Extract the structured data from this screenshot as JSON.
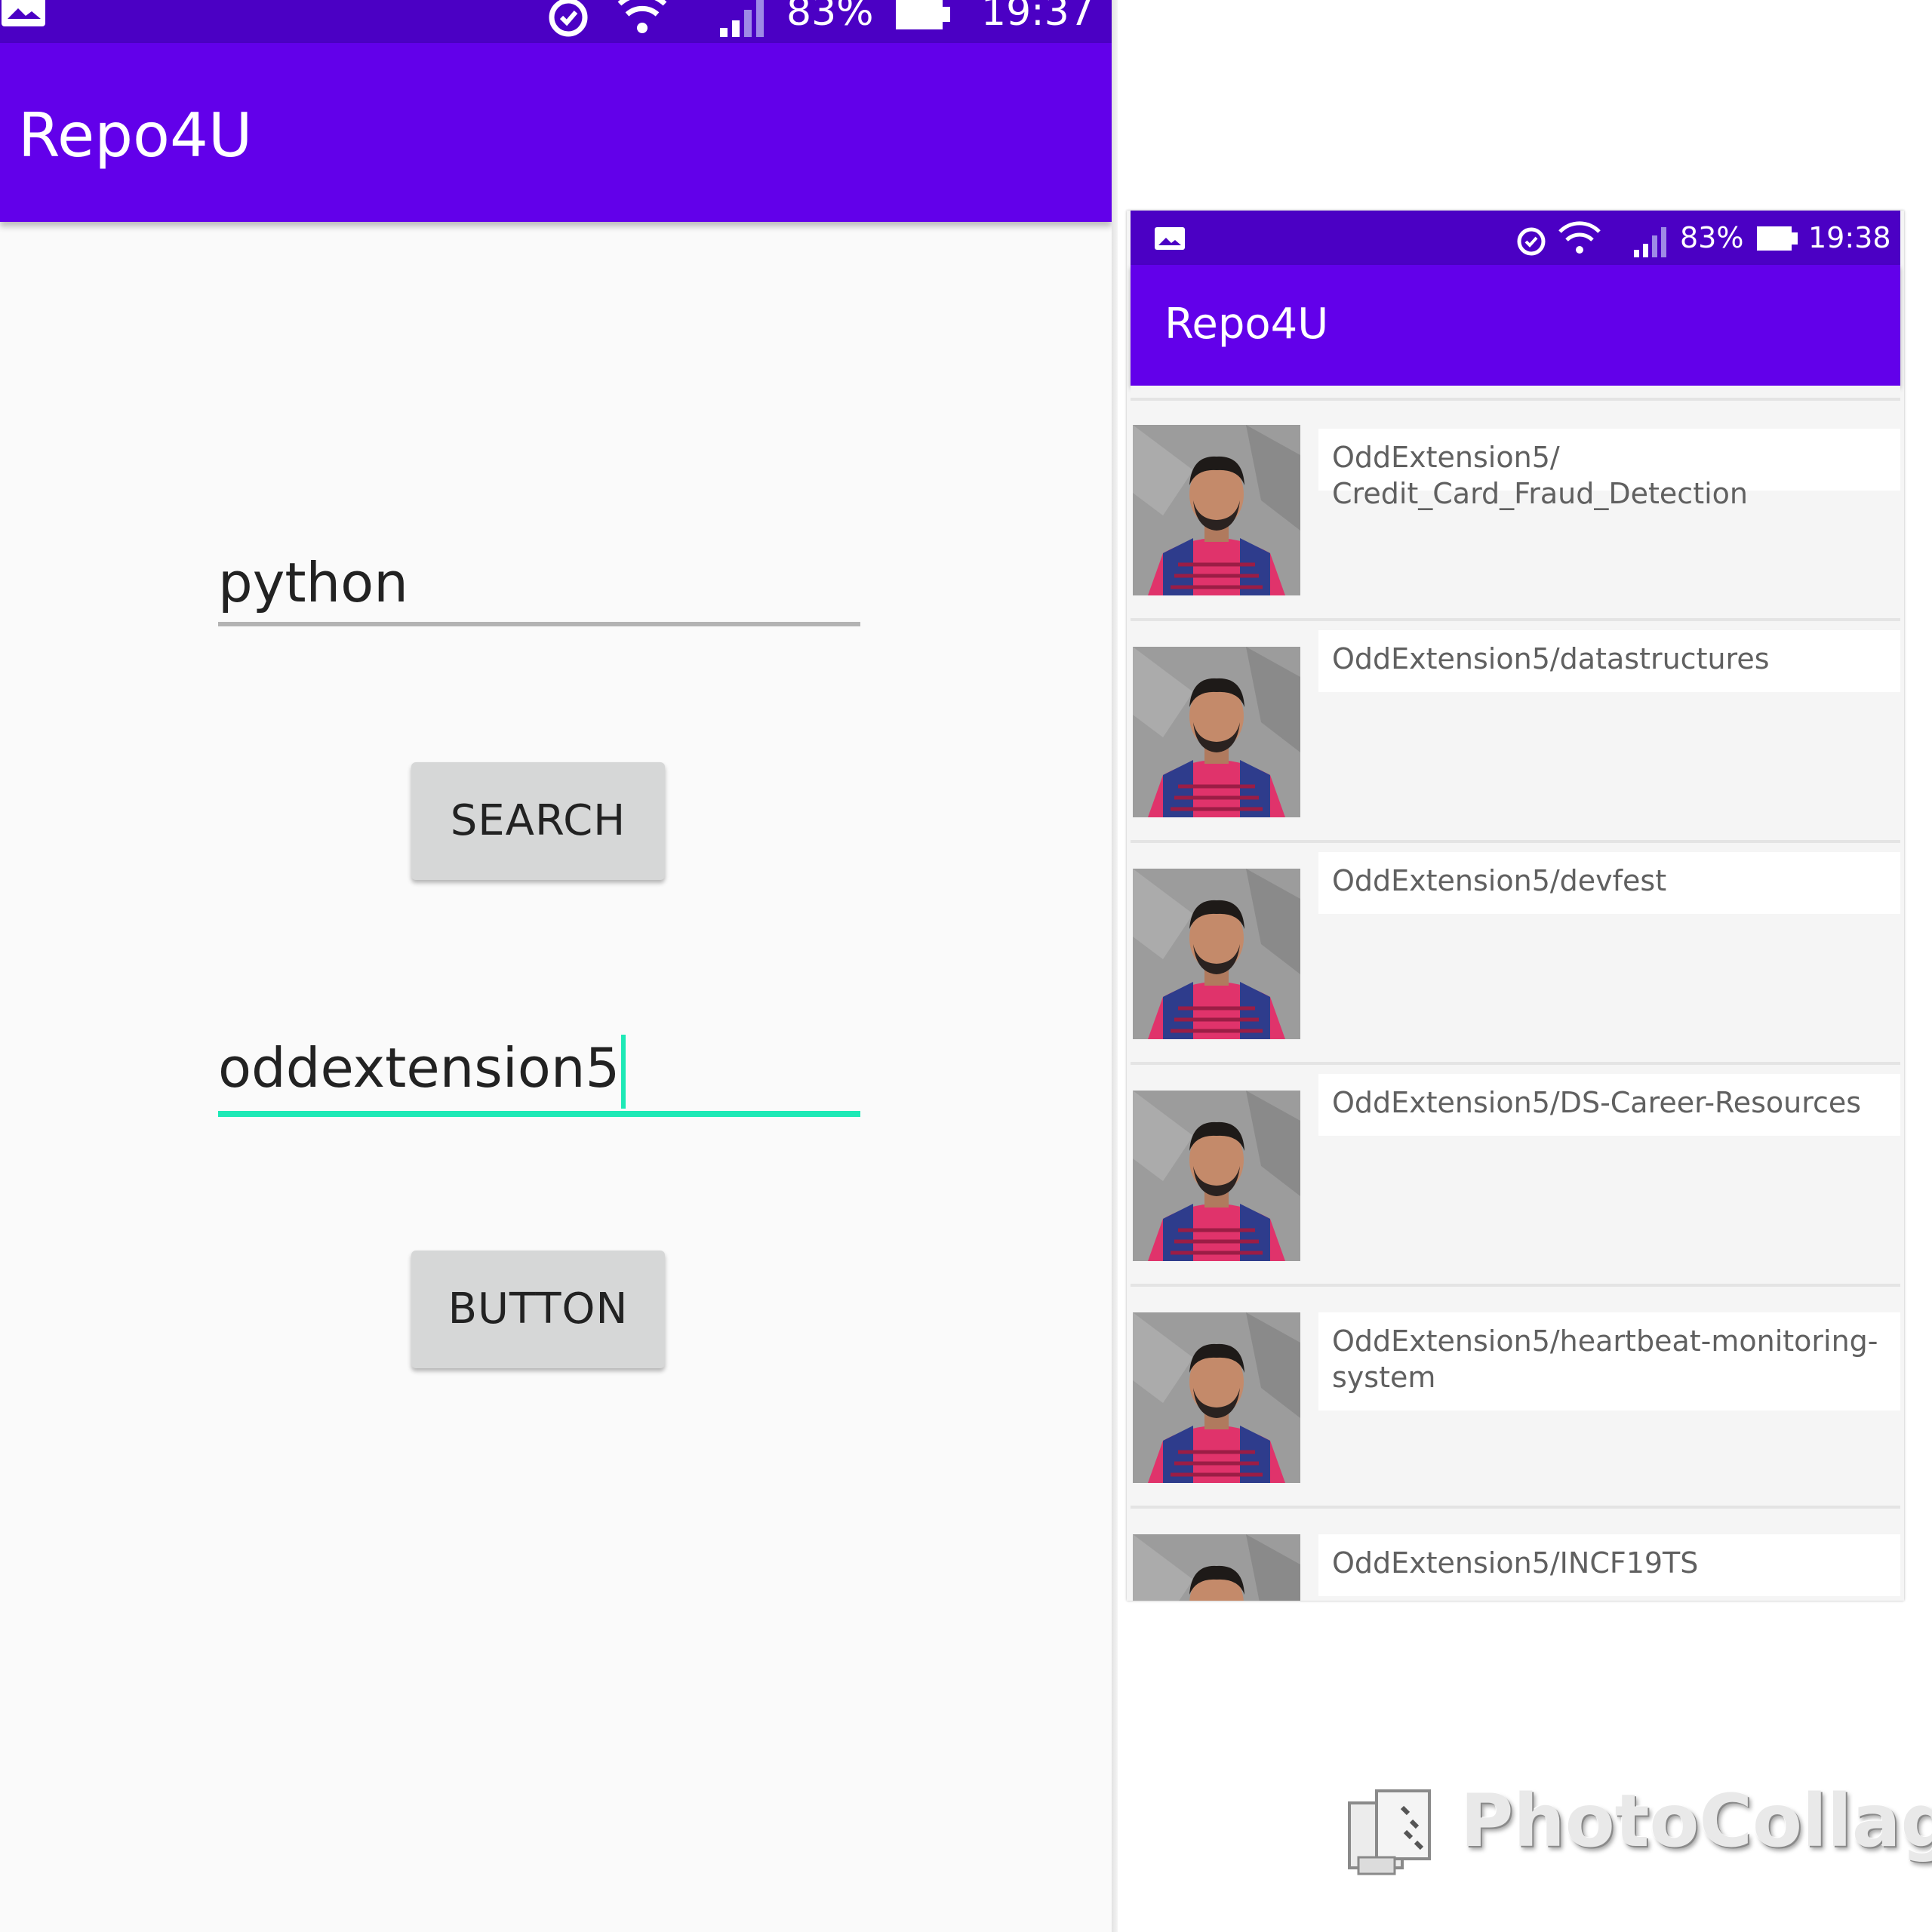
{
  "left_screen": {
    "status_bar": {
      "battery": "83%",
      "time": "19:37"
    },
    "app_bar": {
      "title": "Repo4U"
    },
    "search_field": {
      "value": "python"
    },
    "search_button": {
      "label": "SEARCH"
    },
    "user_field": {
      "value": "oddextension5"
    },
    "second_button": {
      "label": "BUTTON"
    },
    "colors": {
      "accent": "#1de9b6",
      "primary": "#6200ea",
      "primary_dark": "#4b00c4"
    }
  },
  "right_screen": {
    "status_bar": {
      "battery": "83%",
      "time": "19:38"
    },
    "app_bar": {
      "title": "Repo4U"
    },
    "repos": [
      {
        "name": "OddExtension5/ Credit_Card_Fraud_Detection"
      },
      {
        "name": "OddExtension5/datastructures"
      },
      {
        "name": "OddExtension5/devfest"
      },
      {
        "name": "OddExtension5/DS-Career-Resources"
      },
      {
        "name": "OddExtension5/heartbeat-monitoring-system"
      },
      {
        "name": "OddExtension5/INCF19TS"
      }
    ]
  },
  "watermark": {
    "text": "PhotoCollage"
  }
}
